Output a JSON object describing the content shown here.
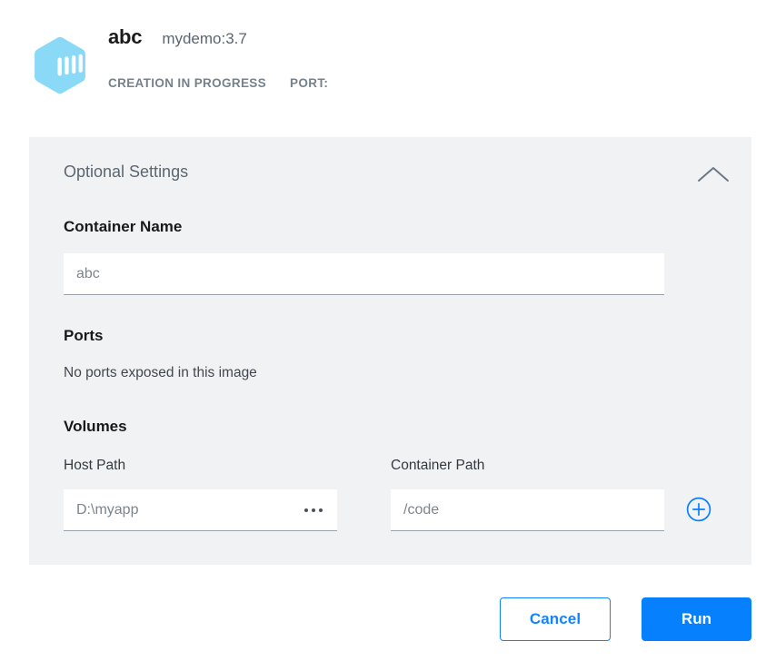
{
  "header": {
    "icon": "container-hexagon-icon",
    "title": "abc",
    "image_name": "mydemo:3.7",
    "status": "CREATION IN PROGRESS",
    "port_label": "PORT:"
  },
  "panel": {
    "title": "Optional Settings",
    "collapse_icon": "chevron-up-icon",
    "container_name": {
      "label": "Container Name",
      "value": "",
      "placeholder": "abc"
    },
    "ports": {
      "label": "Ports",
      "empty_message": "No ports exposed in this image"
    },
    "volumes": {
      "label": "Volumes",
      "host_path_label": "Host Path",
      "container_path_label": "Container Path",
      "host_path_value": "",
      "host_path_placeholder": "D:\\myapp",
      "browse_icon": "ellipsis-icon",
      "container_path_value": "",
      "container_path_placeholder": "/code",
      "add_icon": "plus-circle-icon"
    }
  },
  "footer": {
    "cancel_label": "Cancel",
    "run_label": "Run"
  },
  "colors": {
    "accent": "#0680fd",
    "panel_bg": "#f1f2f4",
    "muted_text": "#5b6670",
    "icon_blue": "#8ad9f7"
  }
}
